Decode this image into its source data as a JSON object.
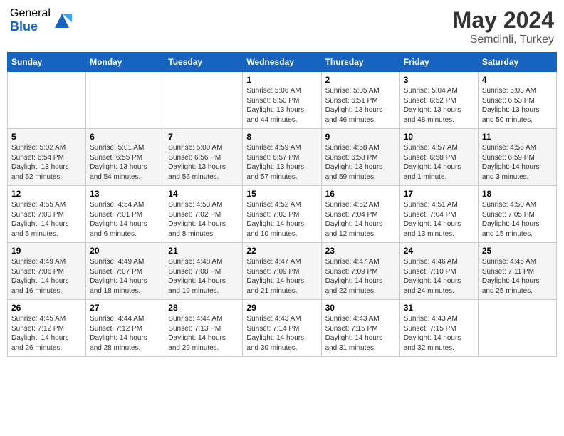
{
  "header": {
    "logo_general": "General",
    "logo_blue": "Blue",
    "title": "May 2024",
    "location": "Semdinli, Turkey"
  },
  "days_of_week": [
    "Sunday",
    "Monday",
    "Tuesday",
    "Wednesday",
    "Thursday",
    "Friday",
    "Saturday"
  ],
  "weeks": [
    [
      {
        "day": "",
        "info": ""
      },
      {
        "day": "",
        "info": ""
      },
      {
        "day": "",
        "info": ""
      },
      {
        "day": "1",
        "info": "Sunrise: 5:06 AM\nSunset: 6:50 PM\nDaylight: 13 hours\nand 44 minutes."
      },
      {
        "day": "2",
        "info": "Sunrise: 5:05 AM\nSunset: 6:51 PM\nDaylight: 13 hours\nand 46 minutes."
      },
      {
        "day": "3",
        "info": "Sunrise: 5:04 AM\nSunset: 6:52 PM\nDaylight: 13 hours\nand 48 minutes."
      },
      {
        "day": "4",
        "info": "Sunrise: 5:03 AM\nSunset: 6:53 PM\nDaylight: 13 hours\nand 50 minutes."
      }
    ],
    [
      {
        "day": "5",
        "info": "Sunrise: 5:02 AM\nSunset: 6:54 PM\nDaylight: 13 hours\nand 52 minutes."
      },
      {
        "day": "6",
        "info": "Sunrise: 5:01 AM\nSunset: 6:55 PM\nDaylight: 13 hours\nand 54 minutes."
      },
      {
        "day": "7",
        "info": "Sunrise: 5:00 AM\nSunset: 6:56 PM\nDaylight: 13 hours\nand 56 minutes."
      },
      {
        "day": "8",
        "info": "Sunrise: 4:59 AM\nSunset: 6:57 PM\nDaylight: 13 hours\nand 57 minutes."
      },
      {
        "day": "9",
        "info": "Sunrise: 4:58 AM\nSunset: 6:58 PM\nDaylight: 13 hours\nand 59 minutes."
      },
      {
        "day": "10",
        "info": "Sunrise: 4:57 AM\nSunset: 6:58 PM\nDaylight: 14 hours\nand 1 minute."
      },
      {
        "day": "11",
        "info": "Sunrise: 4:56 AM\nSunset: 6:59 PM\nDaylight: 14 hours\nand 3 minutes."
      }
    ],
    [
      {
        "day": "12",
        "info": "Sunrise: 4:55 AM\nSunset: 7:00 PM\nDaylight: 14 hours\nand 5 minutes."
      },
      {
        "day": "13",
        "info": "Sunrise: 4:54 AM\nSunset: 7:01 PM\nDaylight: 14 hours\nand 6 minutes."
      },
      {
        "day": "14",
        "info": "Sunrise: 4:53 AM\nSunset: 7:02 PM\nDaylight: 14 hours\nand 8 minutes."
      },
      {
        "day": "15",
        "info": "Sunrise: 4:52 AM\nSunset: 7:03 PM\nDaylight: 14 hours\nand 10 minutes."
      },
      {
        "day": "16",
        "info": "Sunrise: 4:52 AM\nSunset: 7:04 PM\nDaylight: 14 hours\nand 12 minutes."
      },
      {
        "day": "17",
        "info": "Sunrise: 4:51 AM\nSunset: 7:04 PM\nDaylight: 14 hours\nand 13 minutes."
      },
      {
        "day": "18",
        "info": "Sunrise: 4:50 AM\nSunset: 7:05 PM\nDaylight: 14 hours\nand 15 minutes."
      }
    ],
    [
      {
        "day": "19",
        "info": "Sunrise: 4:49 AM\nSunset: 7:06 PM\nDaylight: 14 hours\nand 16 minutes."
      },
      {
        "day": "20",
        "info": "Sunrise: 4:49 AM\nSunset: 7:07 PM\nDaylight: 14 hours\nand 18 minutes."
      },
      {
        "day": "21",
        "info": "Sunrise: 4:48 AM\nSunset: 7:08 PM\nDaylight: 14 hours\nand 19 minutes."
      },
      {
        "day": "22",
        "info": "Sunrise: 4:47 AM\nSunset: 7:09 PM\nDaylight: 14 hours\nand 21 minutes."
      },
      {
        "day": "23",
        "info": "Sunrise: 4:47 AM\nSunset: 7:09 PM\nDaylight: 14 hours\nand 22 minutes."
      },
      {
        "day": "24",
        "info": "Sunrise: 4:46 AM\nSunset: 7:10 PM\nDaylight: 14 hours\nand 24 minutes."
      },
      {
        "day": "25",
        "info": "Sunrise: 4:45 AM\nSunset: 7:11 PM\nDaylight: 14 hours\nand 25 minutes."
      }
    ],
    [
      {
        "day": "26",
        "info": "Sunrise: 4:45 AM\nSunset: 7:12 PM\nDaylight: 14 hours\nand 26 minutes."
      },
      {
        "day": "27",
        "info": "Sunrise: 4:44 AM\nSunset: 7:12 PM\nDaylight: 14 hours\nand 28 minutes."
      },
      {
        "day": "28",
        "info": "Sunrise: 4:44 AM\nSunset: 7:13 PM\nDaylight: 14 hours\nand 29 minutes."
      },
      {
        "day": "29",
        "info": "Sunrise: 4:43 AM\nSunset: 7:14 PM\nDaylight: 14 hours\nand 30 minutes."
      },
      {
        "day": "30",
        "info": "Sunrise: 4:43 AM\nSunset: 7:15 PM\nDaylight: 14 hours\nand 31 minutes."
      },
      {
        "day": "31",
        "info": "Sunrise: 4:43 AM\nSunset: 7:15 PM\nDaylight: 14 hours\nand 32 minutes."
      },
      {
        "day": "",
        "info": ""
      }
    ]
  ]
}
